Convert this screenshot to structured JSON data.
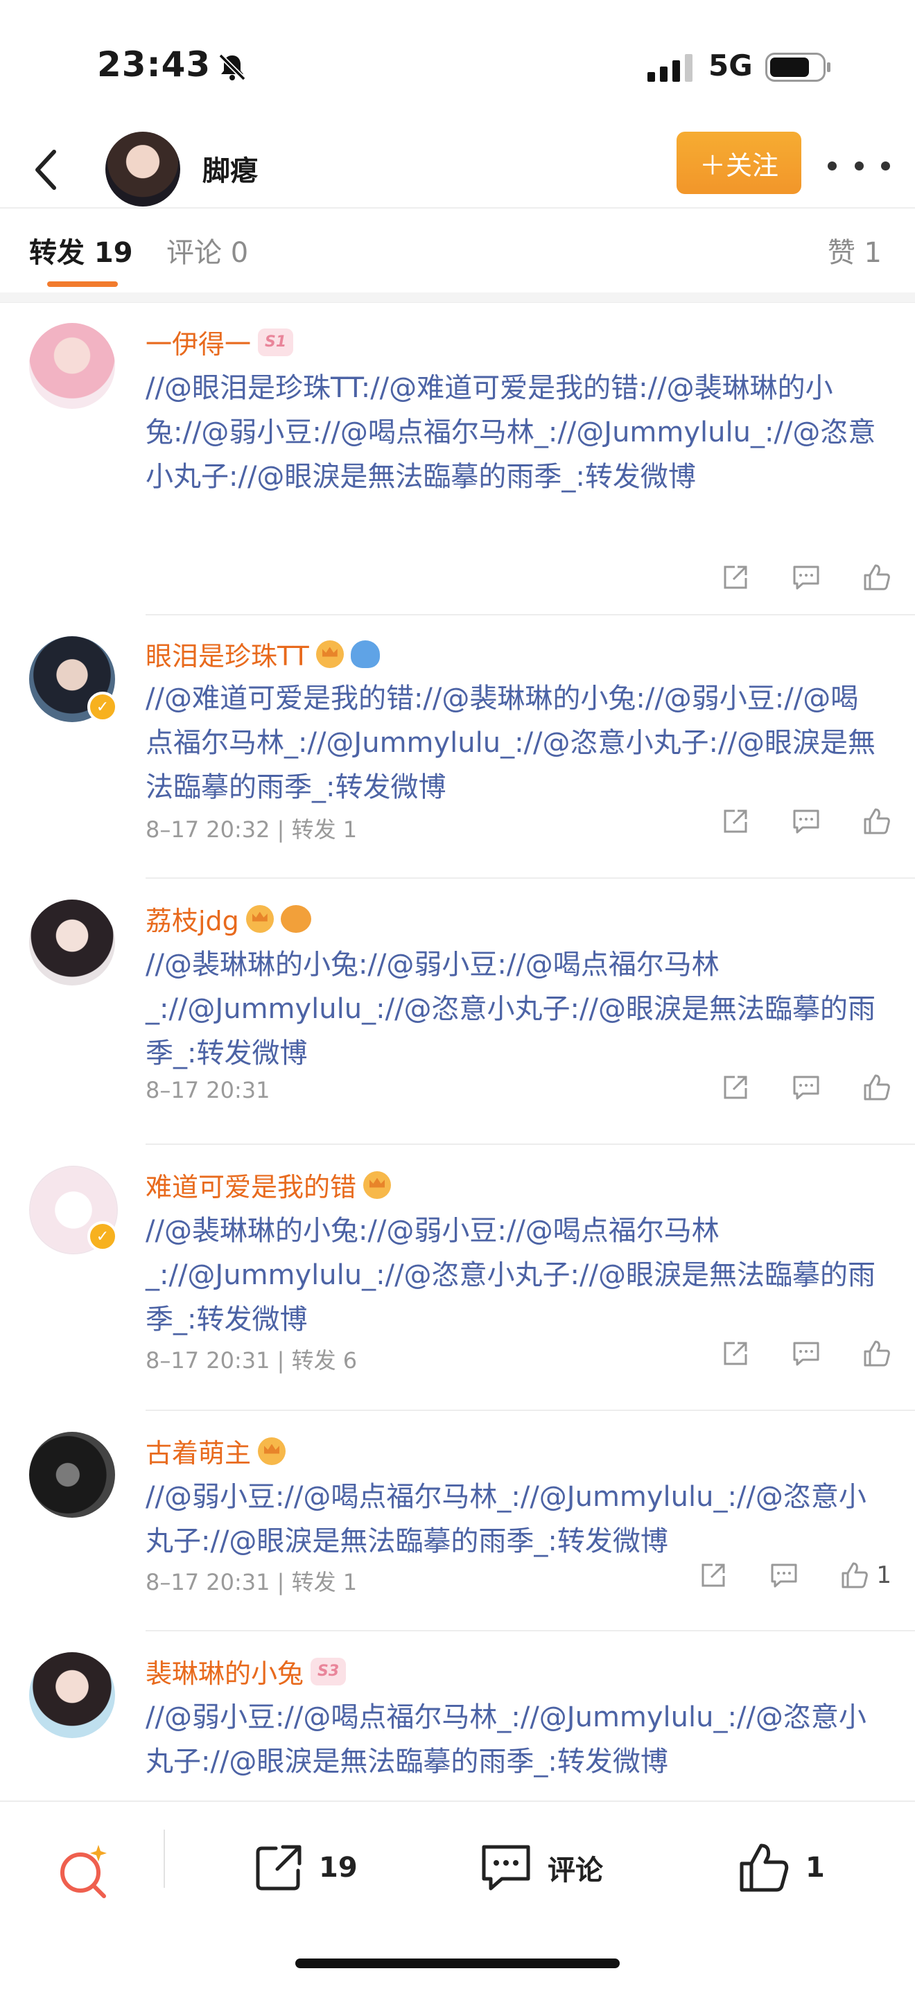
{
  "status_bar": {
    "time": "23:43",
    "network": "5G"
  },
  "nav": {
    "user_name": "脚瘪",
    "follow_label": "＋关注"
  },
  "tabs": {
    "repost": "转发 19",
    "comment": "评论 0",
    "like": "赞 1"
  },
  "colors": {
    "accent_orange": "#f27b2d",
    "mention_blue": "#4c63a5",
    "username_orange": "#e86a1d",
    "follow_button": "#f5a623"
  },
  "feed": [
    {
      "name": "一伊得一",
      "badges": [
        "membership-s1"
      ],
      "badge_text": "S1",
      "verified": false,
      "content": "//@眼泪是珍珠TT://@难道可爱是我的错://@裴琳琳的小兔://@弱小豆://@喝点福尔马林_://@Jummylulu_://@恣意小丸子://@眼淚是無法臨摹的雨季_:转发微博",
      "meta": "",
      "like_count": ""
    },
    {
      "name": "眼泪是珍珠TT",
      "badges": [
        "crown-icon",
        "shark-icon"
      ],
      "verified": true,
      "content": "//@难道可爱是我的错://@裴琳琳的小兔://@弱小豆://@喝点福尔马林_://@Jummylulu_://@恣意小丸子://@眼淚是無法臨摹的雨季_:转发微博",
      "meta": "8–17 20:32 | 转发 1",
      "like_count": ""
    },
    {
      "name": "荔枝jdg",
      "badges": [
        "crown-icon",
        "fish-icon"
      ],
      "verified": false,
      "content": "//@裴琳琳的小兔://@弱小豆://@喝点福尔马林_://@Jummylulu_://@恣意小丸子://@眼淚是無法臨摹的雨季_:转发微博",
      "meta": "8–17 20:31",
      "like_count": ""
    },
    {
      "name": "难道可爱是我的错",
      "badges": [
        "crown-icon"
      ],
      "verified": true,
      "content": "//@裴琳琳的小兔://@弱小豆://@喝点福尔马林_://@Jummylulu_://@恣意小丸子://@眼淚是無法臨摹的雨季_:转发微博",
      "meta": "8–17 20:31 | 转发 6",
      "like_count": ""
    },
    {
      "name": "古着萌主",
      "badges": [
        "crown-icon"
      ],
      "verified": false,
      "content": "//@弱小豆://@喝点福尔马林_://@Jummylulu_://@恣意小丸子://@眼淚是無法臨摹的雨季_:转发微博",
      "meta": "8–17 20:31 | 转发 1",
      "like_count": "1"
    },
    {
      "name": "裴琳琳的小兔",
      "badges": [
        "membership-s3"
      ],
      "badge_text": "S3",
      "verified": false,
      "content": "//@弱小豆://@喝点福尔马林_://@Jummylulu_://@恣意小丸子://@眼淚是無法臨摹的雨季_:转发微博",
      "meta": "",
      "like_count": ""
    }
  ],
  "bottom_bar": {
    "repost_count": "19",
    "comment_label": "评论",
    "like_count": "1"
  }
}
